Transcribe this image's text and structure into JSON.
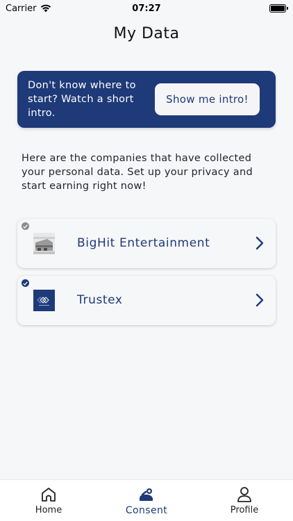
{
  "status_bar": {
    "carrier": "Carrier",
    "time": "07:27"
  },
  "page": {
    "title": "My Data"
  },
  "intro_banner": {
    "text": "Don't know where to start? Watch a short intro.",
    "button_label": "Show me intro!"
  },
  "description": "Here are the companies that have collected your personal data. Set up your privacy and start earning right now!",
  "companies": [
    {
      "name": "BigHit Entertainment",
      "checked_state": "gray"
    },
    {
      "name": "Trustex",
      "checked_state": "blue"
    }
  ],
  "tabs": [
    {
      "label": "Home",
      "icon": "home-icon",
      "active": false
    },
    {
      "label": "Consent",
      "icon": "consent-icon",
      "active": true
    },
    {
      "label": "Profile",
      "icon": "profile-icon",
      "active": false
    }
  ],
  "colors": {
    "brand": "#1e3a78",
    "background": "#f6f7f9",
    "check_gray": "#8c8c8c"
  }
}
